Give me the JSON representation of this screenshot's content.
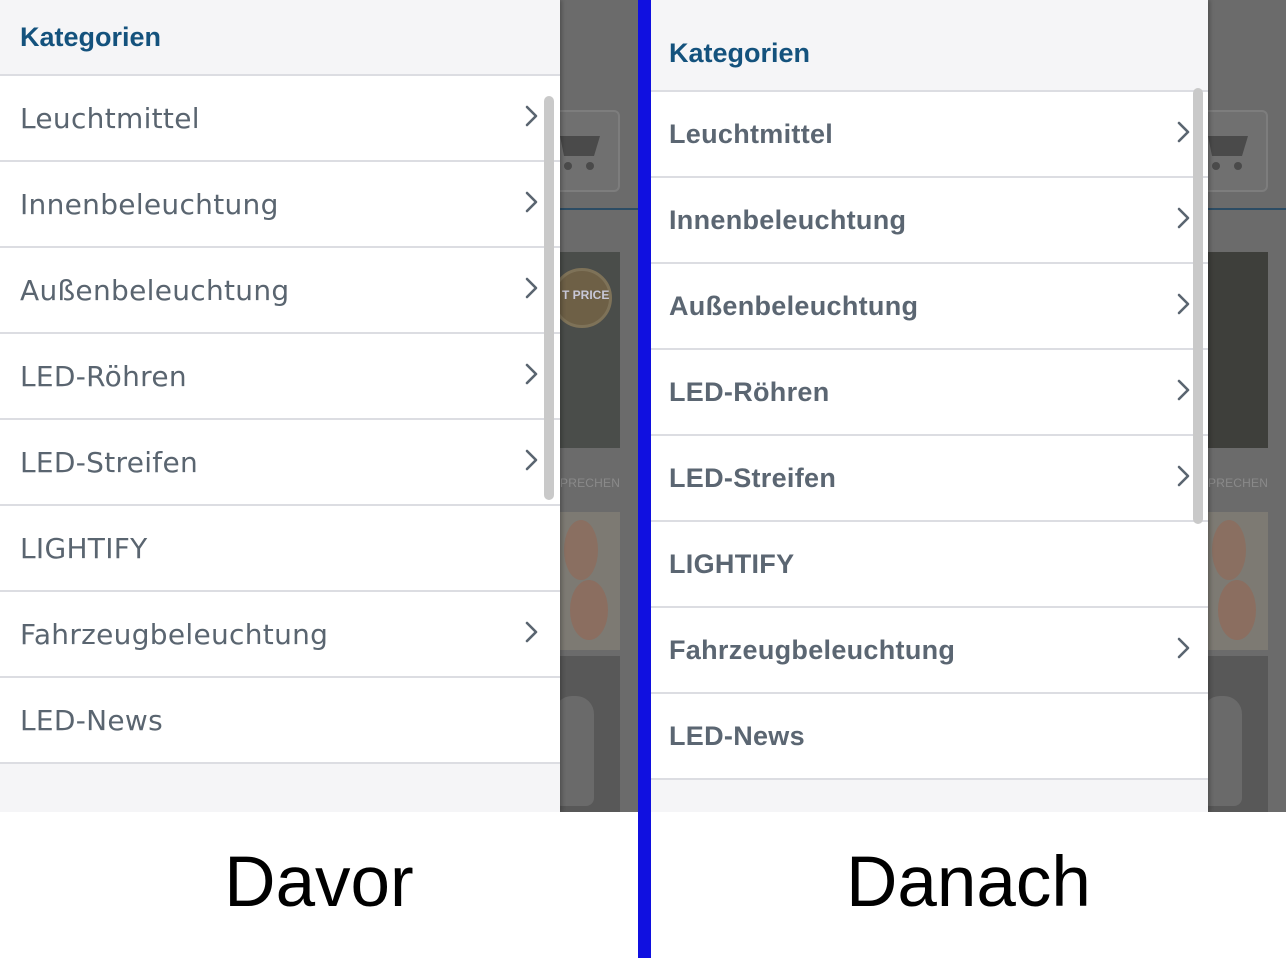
{
  "before": {
    "menu_title": "Kategorien",
    "items": [
      {
        "label": "Leuchtmittel",
        "has_submenu": true
      },
      {
        "label": "Innenbeleuchtung",
        "has_submenu": true
      },
      {
        "label": "Außenbeleuchtung",
        "has_submenu": true
      },
      {
        "label": "LED-Röhren",
        "has_submenu": true
      },
      {
        "label": "LED-Streifen",
        "has_submenu": true
      },
      {
        "label": "LIGHTIFY",
        "has_submenu": false
      },
      {
        "label": "Fahrzeugbeleuchtung",
        "has_submenu": true
      },
      {
        "label": "LED-News",
        "has_submenu": false
      }
    ],
    "background": {
      "badge_text": "T PRICE",
      "promo_text": "PRECHEN"
    },
    "caption": "Davor"
  },
  "after": {
    "menu_title": "Kategorien",
    "items": [
      {
        "label": "Leuchtmittel",
        "has_submenu": true
      },
      {
        "label": "Innenbeleuchtung",
        "has_submenu": true
      },
      {
        "label": "Außenbeleuchtung",
        "has_submenu": true
      },
      {
        "label": "LED-Röhren",
        "has_submenu": true
      },
      {
        "label": "LED-Streifen",
        "has_submenu": true
      },
      {
        "label": "LIGHTIFY",
        "has_submenu": false
      },
      {
        "label": "Fahrzeugbeleuchtung",
        "has_submenu": true
      },
      {
        "label": "LED-News",
        "has_submenu": false
      }
    ],
    "background": {
      "promo_text": "PRECHEN"
    },
    "caption": "Danach"
  },
  "colors": {
    "title": "#14527d",
    "item_text": "#5a6570",
    "divider": "#1010e0",
    "header_bg": "#f5f5f7"
  },
  "icons": {
    "submenu": "chevron-right-icon",
    "cart": "shopping-cart-icon"
  }
}
